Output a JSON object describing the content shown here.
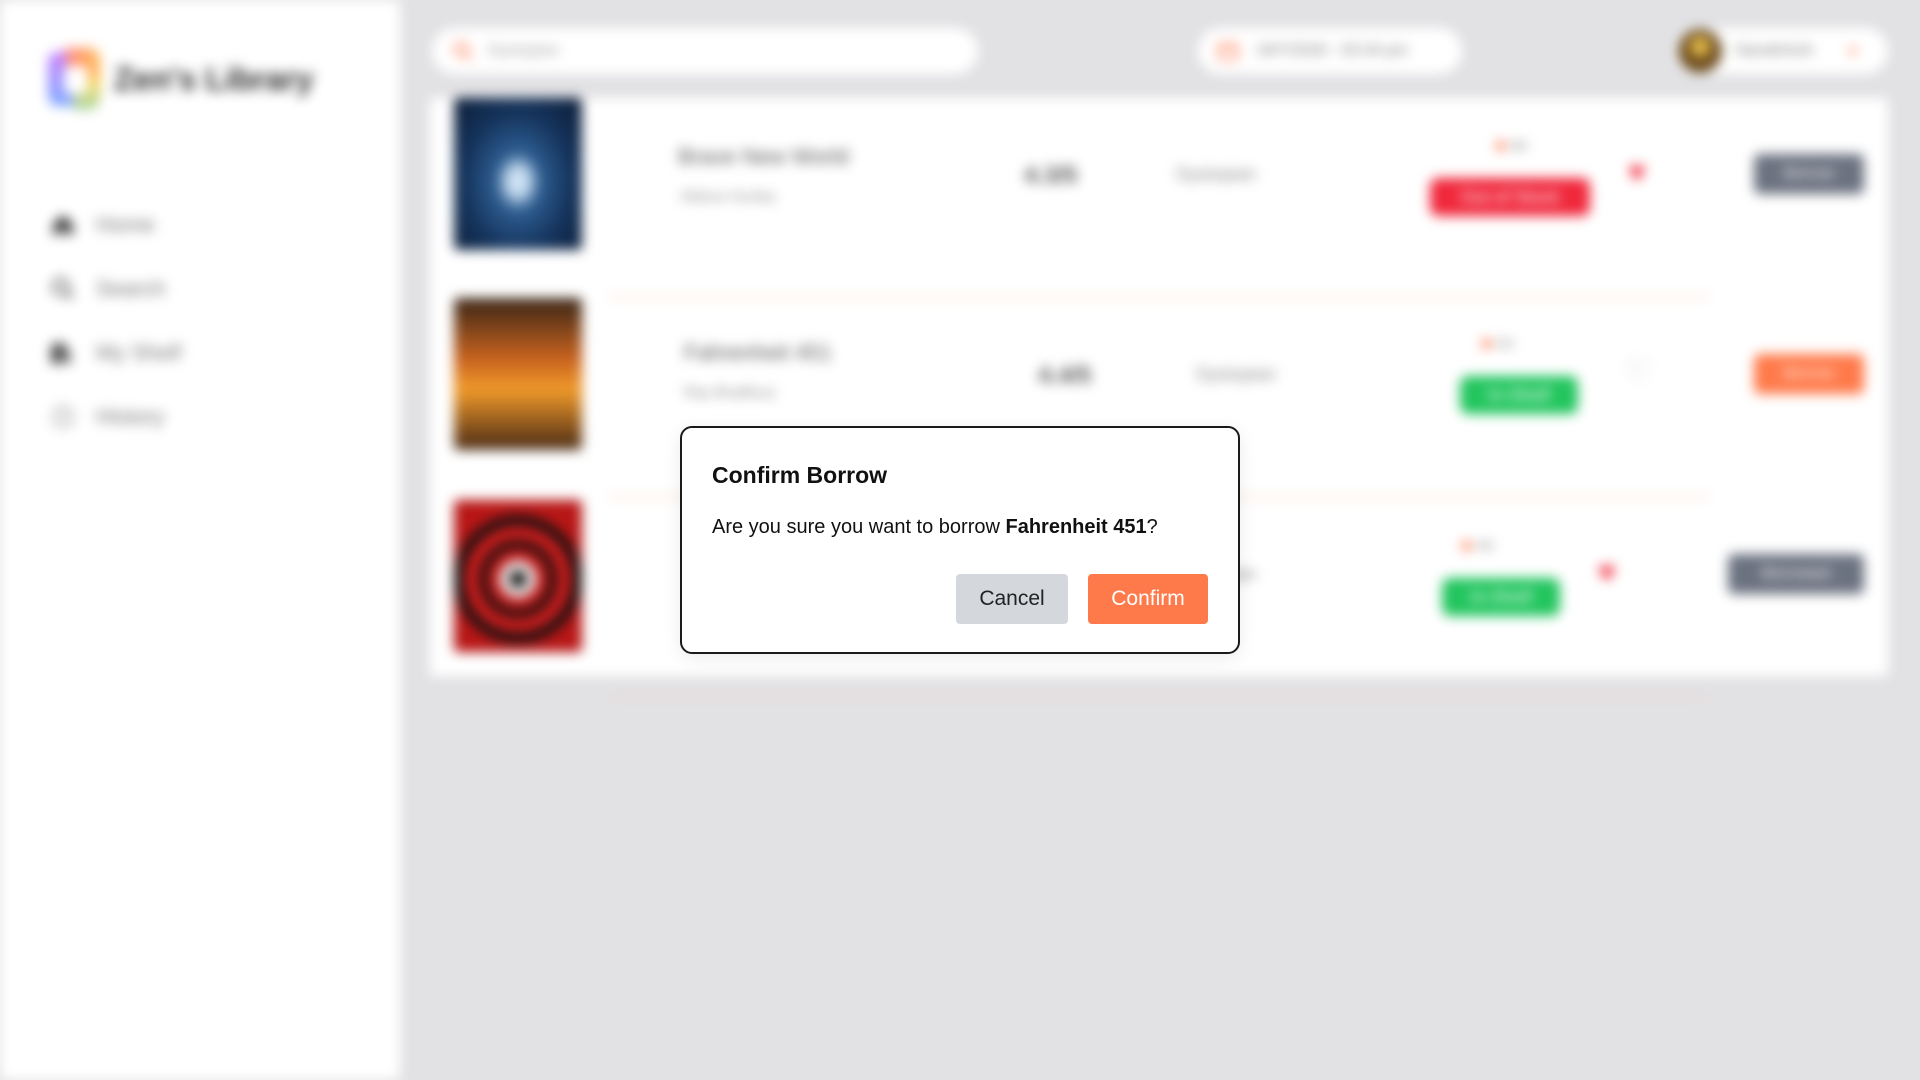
{
  "app": {
    "name": "Zen's Library"
  },
  "sidebar": {
    "items": [
      {
        "label": "Home",
        "icon": "home-icon"
      },
      {
        "label": "Search",
        "icon": "search-icon"
      },
      {
        "label": "My Shelf",
        "icon": "shelf-icon"
      },
      {
        "label": "History",
        "icon": "history-icon"
      }
    ]
  },
  "topbar": {
    "search_value": "Dystopian",
    "datetime": "18/7/2026 - 03:34 pm",
    "user_name": "Nandinhoh"
  },
  "books": [
    {
      "title": "Brave New World",
      "author": "Aldous Huxley",
      "rating": "4.3/5",
      "genre": "Dystopian",
      "location": "B4",
      "status": "Out of Stock",
      "favorite": true,
      "action": "Borrow"
    },
    {
      "title": "Fahrenheit 451",
      "author": "Ray Bradbury",
      "rating": "4.4/5",
      "genre": "Dystopian",
      "location": "E3",
      "status": "In-Shelf",
      "favorite": false,
      "action": "Borrow"
    },
    {
      "title": "",
      "author": "",
      "rating": "",
      "genre": "Dystopian",
      "location": "R2",
      "status": "In-Shelf",
      "favorite": true,
      "action": "Borrowed"
    }
  ],
  "colors": {
    "accent": "#ff7a4a",
    "out_of_stock": "#f0283c",
    "in_shelf": "#22c55e",
    "muted_button": "#6b7280",
    "heart": "#ef2b3c"
  },
  "modal": {
    "title": "Confirm Borrow",
    "message_prefix": "Are you sure you want to borrow ",
    "book_title": "Fahrenheit 451",
    "message_suffix": "?",
    "cancel_label": "Cancel",
    "confirm_label": "Confirm"
  }
}
